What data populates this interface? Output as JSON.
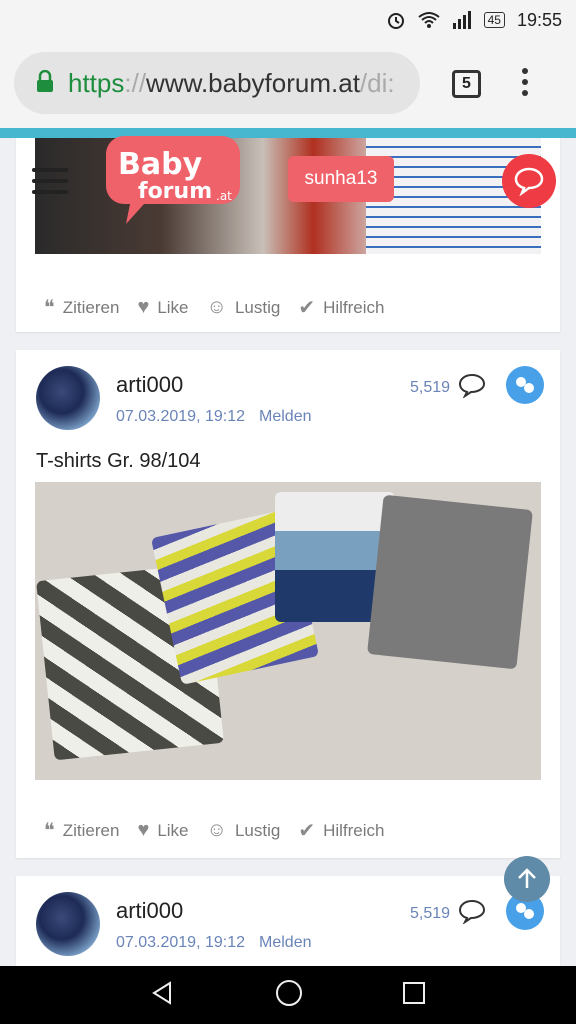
{
  "status": {
    "time": "19:55",
    "battery": "45"
  },
  "browser": {
    "url_scheme": "https",
    "url_sep": "://",
    "url_host": "www.babyforum.at",
    "url_rest": "/di:",
    "tab_count": "5"
  },
  "site": {
    "logo_text": "Baby forum",
    "logo_suffix": ".at",
    "logged_user": "sunha13"
  },
  "actions": {
    "quote": "Zitieren",
    "like": "Like",
    "funny": "Lustig",
    "helpful": "Hilfreich"
  },
  "posts": [
    {
      "author": "arti000",
      "date": "07.03.2019, 19:12",
      "report": "Melden",
      "count": "5,519",
      "title": "T-shirts Gr. 98/104"
    },
    {
      "author": "arti000",
      "date": "07.03.2019, 19:12",
      "report": "Melden",
      "count": "5,519"
    }
  ],
  "colors": {
    "accent": "#47b7cf",
    "brand": "#f0626a",
    "link": "#6a84b8",
    "fab": "#ee3b44"
  }
}
